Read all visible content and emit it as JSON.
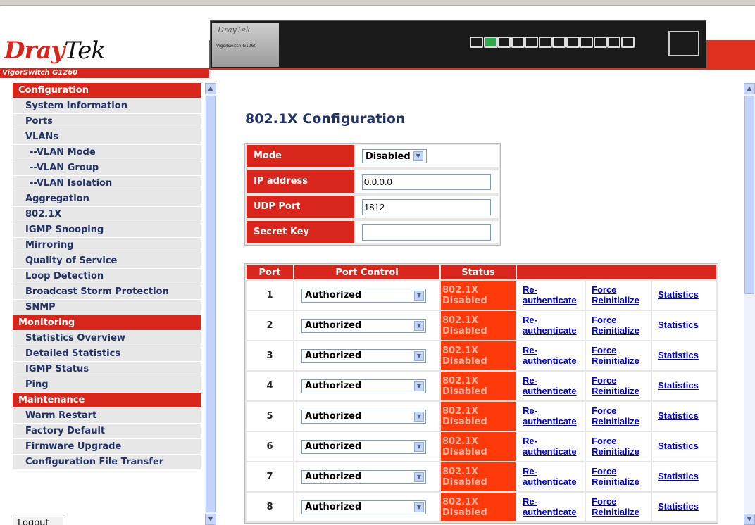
{
  "brand": {
    "logo_first": "Dray",
    "logo_second": "Tek",
    "model": "VigorSwitch G1260",
    "device_brand": "DrayTek",
    "device_model": "VigorSwitch G1260"
  },
  "sidebar": {
    "sections": [
      {
        "header": "Configuration",
        "items": [
          "System Information",
          "Ports",
          "VLANs",
          "--VLAN Mode",
          "--VLAN Group",
          "--VLAN Isolation",
          "Aggregation",
          "802.1X",
          "IGMP Snooping",
          "Mirroring",
          "Quality of Service",
          "Loop Detection",
          "Broadcast Storm Protection",
          "SNMP"
        ]
      },
      {
        "header": "Monitoring",
        "items": [
          "Statistics Overview",
          "Detailed Statistics",
          "IGMP Status",
          "Ping"
        ]
      },
      {
        "header": "Maintenance",
        "items": [
          "Warm Restart",
          "Factory Default",
          "Firmware Upgrade",
          "Configuration File Transfer"
        ]
      }
    ],
    "logout": "Logout"
  },
  "main": {
    "title": "802.1X Configuration",
    "config": {
      "mode_label": "Mode",
      "mode_value": "Disabled",
      "ip_label": "IP address",
      "ip_value": "0.0.0.0",
      "udp_label": "UDP Port",
      "udp_value": "1812",
      "secret_label": "Secret Key",
      "secret_value": ""
    },
    "table": {
      "headers": [
        "Port",
        "Port Control",
        "Status",
        ""
      ],
      "rows": [
        {
          "port": "1",
          "control": "Authorized",
          "status1": "802.1X",
          "status2": "Disabled"
        },
        {
          "port": "2",
          "control": "Authorized",
          "status1": "802.1X",
          "status2": "Disabled"
        },
        {
          "port": "3",
          "control": "Authorized",
          "status1": "802.1X",
          "status2": "Disabled"
        },
        {
          "port": "4",
          "control": "Authorized",
          "status1": "802.1X",
          "status2": "Disabled"
        },
        {
          "port": "5",
          "control": "Authorized",
          "status1": "802.1X",
          "status2": "Disabled"
        },
        {
          "port": "6",
          "control": "Authorized",
          "status1": "802.1X",
          "status2": "Disabled"
        },
        {
          "port": "7",
          "control": "Authorized",
          "status1": "802.1X",
          "status2": "Disabled"
        },
        {
          "port": "8",
          "control": "Authorized",
          "status1": "802.1X",
          "status2": "Disabled"
        }
      ],
      "link_reauth_1": "Re-",
      "link_reauth_2": "authenticate",
      "link_force_1": "Force",
      "link_force_2": "Reinitialize",
      "link_stats": "Statistics"
    }
  },
  "colors": {
    "accent_red": "#d8261c",
    "status_bg": "#ff3a0a",
    "nav_text": "#223366",
    "link": "#0000cc"
  }
}
